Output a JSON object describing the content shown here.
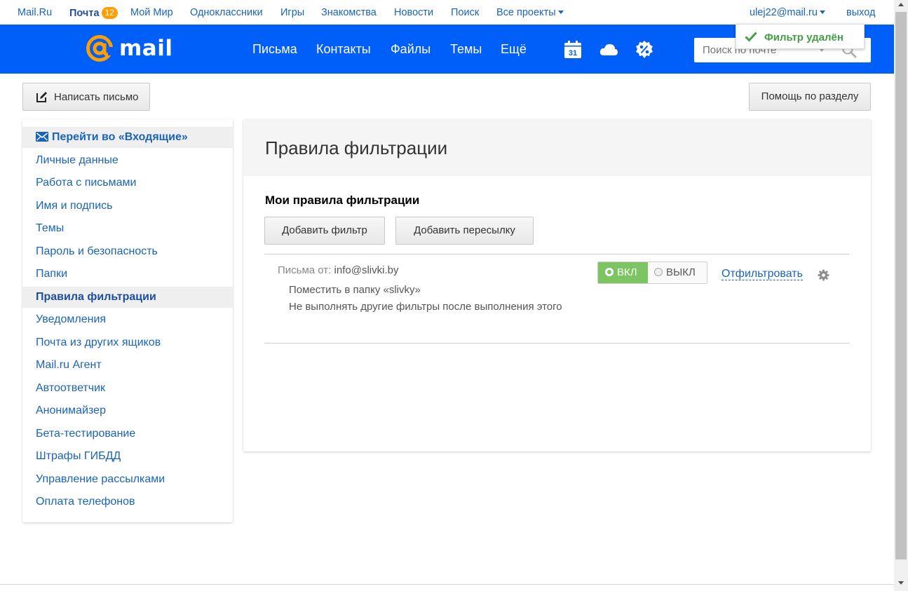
{
  "portal_nav": {
    "items": [
      "Mail.Ru",
      "Почта",
      "Мой Мир",
      "Одноклассники",
      "Игры",
      "Знакомства",
      "Новости",
      "Поиск",
      "Все проекты"
    ],
    "mail_badge": "12",
    "user_email": "ulej22@mail.ru",
    "logout": "выход"
  },
  "header": {
    "logo_text": "mail",
    "nav": [
      "Письма",
      "Контакты",
      "Файлы",
      "Темы",
      "Ещё"
    ],
    "calendar_day": "31",
    "search_placeholder": "Поиск по почте",
    "icons": [
      "calendar-icon",
      "cloud-icon",
      "discount-icon",
      "search-icon"
    ],
    "brand_color": "#005ff9"
  },
  "notification": {
    "text": "Фильтр удалён",
    "color": "#43a047"
  },
  "toolbar": {
    "compose_label": "Написать письмо",
    "help_label": "Помощь по разделу"
  },
  "sidebar": {
    "inbox_link": "Перейти во «Входящие»",
    "items": [
      "Личные данные",
      "Работа с письмами",
      "Имя и подпись",
      "Темы",
      "Пароль и безопасность",
      "Папки",
      "Правила фильтрации",
      "Уведомления",
      "Почта из других ящиков",
      "Mail.ru Агент",
      "Автоответчик",
      "Анонимайзер",
      "Бета-тестирование",
      "Штрафы ГИБДД",
      "Управление рассылками",
      "Оплата телефонов"
    ],
    "active_item": "Правила фильтрации"
  },
  "main": {
    "title": "Правила фильтрации",
    "subtitle": "Мои правила фильтрации",
    "add_filter_label": "Добавить фильтр",
    "add_forward_label": "Добавить пересылку",
    "rule": {
      "from_label": "Письма от:",
      "from_value": "info@slivki.by",
      "action_1": "Поместить в папку «slivky»",
      "action_2": "Не выполнять другие фильтры после выполнения этого",
      "on_label": "ВКЛ",
      "off_label": "ВЫКЛ",
      "enabled": true,
      "filter_link": "Отфильтровать"
    }
  }
}
